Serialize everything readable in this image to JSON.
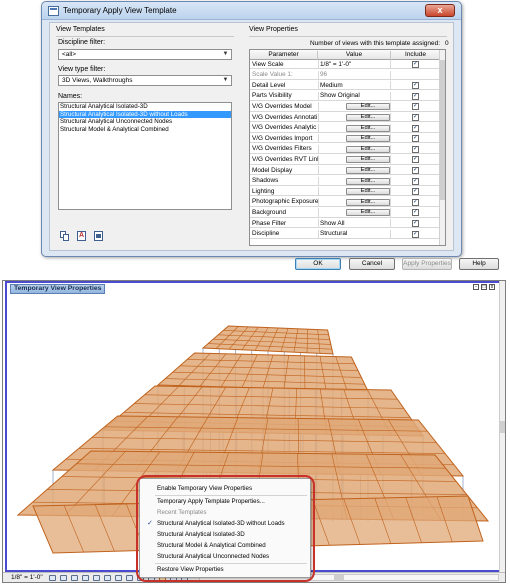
{
  "dialog": {
    "title": "Temporary Apply View Template",
    "close_glyph": "x",
    "view_templates_label": "View Templates",
    "discipline_filter_label": "Discipline filter:",
    "discipline_filter_value": "<all>",
    "view_type_filter_label": "View type filter:",
    "view_type_filter_value": "3D Views, Walkthroughs",
    "names_label": "Names:",
    "names": [
      "Structural Analytical Isolated-3D",
      "Structural Analytical Isolated-3D without Loads",
      "Structural Analytical Unconnected Nodes",
      "Structural Model & Analytical Combined"
    ],
    "selected_index": 1,
    "view_properties_label": "View Properties",
    "assigned_count_label": "Number of views with this template assigned:",
    "assigned_count": "0",
    "table_headers": {
      "parameter": "Parameter",
      "value": "Value",
      "include": "Include"
    },
    "properties": [
      {
        "parameter": "View Scale",
        "value": "1/8\" = 1'-0\"",
        "type": "text",
        "include": true
      },
      {
        "parameter": "Scale Value   1:",
        "value": "96",
        "type": "dim",
        "include": null
      },
      {
        "parameter": "Detail Level",
        "value": "Medium",
        "type": "text",
        "include": true
      },
      {
        "parameter": "Parts Visibility",
        "value": "Show Original",
        "type": "text",
        "include": true
      },
      {
        "parameter": "V/G Overrides Model",
        "value": "Edit...",
        "type": "button",
        "include": true
      },
      {
        "parameter": "V/G Overrides Annotati",
        "value": "Edit...",
        "type": "button",
        "include": true
      },
      {
        "parameter": "V/G Overrides Analytic",
        "value": "Edit...",
        "type": "button",
        "include": true
      },
      {
        "parameter": "V/G Overrides Import",
        "value": "Edit...",
        "type": "button",
        "include": true
      },
      {
        "parameter": "V/G Overrides Filters",
        "value": "Edit...",
        "type": "button",
        "include": true
      },
      {
        "parameter": "V/G Overrides RVT Link",
        "value": "Edit...",
        "type": "button",
        "include": true
      },
      {
        "parameter": "Model Display",
        "value": "Edit...",
        "type": "button",
        "include": true
      },
      {
        "parameter": "Shadows",
        "value": "Edit...",
        "type": "button",
        "include": true
      },
      {
        "parameter": "Lighting",
        "value": "Edit...",
        "type": "button",
        "include": true
      },
      {
        "parameter": "Photographic Exposure",
        "value": "Edit...",
        "type": "button",
        "include": true
      },
      {
        "parameter": "Background",
        "value": "Edit...",
        "type": "button",
        "include": true
      },
      {
        "parameter": "Phase Filter",
        "value": "Show All",
        "type": "text",
        "include": true
      },
      {
        "parameter": "Discipline",
        "value": "Structural",
        "type": "text",
        "include": true
      }
    ],
    "buttons": {
      "ok": "OK",
      "cancel": "Cancel",
      "apply": "Apply Properties",
      "help": "Help"
    }
  },
  "view": {
    "title": "Temporary View Properties",
    "scale": "1/8\" = 1'-0\"",
    "colors": {
      "frame": "#4b4bcf",
      "deck": "#e0a877",
      "beam": "#c0621c",
      "column": "#8da0c4"
    }
  },
  "context_menu": {
    "enable": "Enable Temporary View Properties",
    "apply": "Temporary Apply Template Properties...",
    "recent_header": "Recent Templates",
    "recent": [
      {
        "label": "Structural Analytical Isolated-3D without Loads",
        "checked": true
      },
      {
        "label": "Structural Analytical Isolated-3D",
        "checked": false
      },
      {
        "label": "Structural Model & Analytical Combined",
        "checked": false
      },
      {
        "label": "Structural Analytical Unconnected Nodes",
        "checked": false
      }
    ],
    "restore": "Restore View Properties",
    "check_glyph": "✓",
    "highlight_color": "#c8312a"
  }
}
